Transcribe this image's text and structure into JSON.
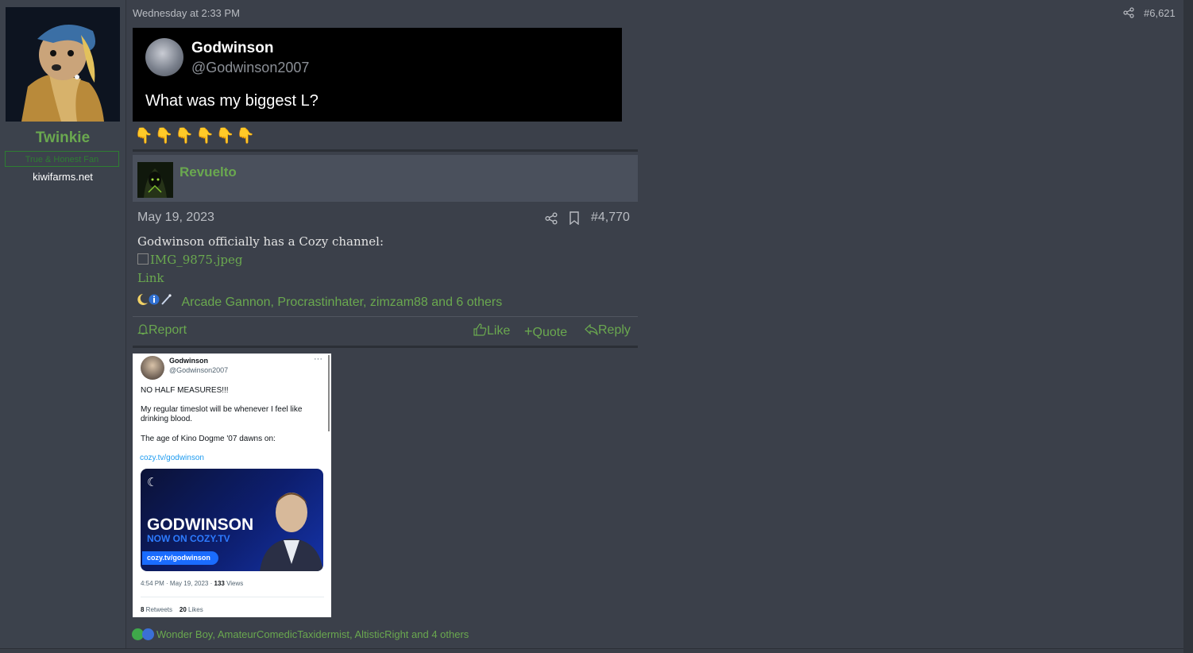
{
  "user": {
    "name": "Twinkie",
    "title": "True & Honest Fan",
    "site": "kiwifarms.net"
  },
  "post": {
    "timestamp": "Wednesday at 2:33 PM",
    "number": "#6,621",
    "embedded_tweet": {
      "name": "Godwinson",
      "handle": "@Godwinson2007",
      "text": "What was my biggest L?"
    },
    "emoji_row": "👇👇👇👇👇👇",
    "reactions_text": "Wonder Boy, AmateurComedicTaxidermist, AltisticRight and 4 others"
  },
  "quote": {
    "author": "Revuelto",
    "date": "May 19, 2023",
    "number": "#4,770",
    "body": "Godwinson officially has a Cozy channel:",
    "image_alt": "IMG_9875.jpeg",
    "link_label": "Link",
    "reactions_text": "Arcade Gannon, Procrastinhater, zimzam88 and 6 others",
    "actions": {
      "report": "Report",
      "like": "Like",
      "quote": "Quote",
      "reply": "Reply"
    }
  },
  "tweet_image": {
    "name": "Godwinson",
    "handle": "@Godwinson2007",
    "more": "···",
    "line1": "NO HALF MEASURES!!!",
    "line2a": "My regular timeslot will be whenever I feel like",
    "line2b": "drinking blood.",
    "line3": "The age of Kino Dogme '07 dawns on:",
    "link": "cozy.tv/godwinson",
    "card_title": "GODWINSON",
    "card_subtitle": "NOW ON COZY.TV",
    "card_pill": "cozy.tv/godwinson",
    "meta_prefix": "4:54 PM · May 19, 2023 · ",
    "views_count": "133",
    "views_label": " Views",
    "retweets_count": "8",
    "retweets_label": " Retweets",
    "likes_count": "20",
    "likes_label": " Likes"
  },
  "colors": {
    "accent_green": "#6aa84f",
    "background": "#3b404a",
    "tweet_dark": "#000000"
  }
}
